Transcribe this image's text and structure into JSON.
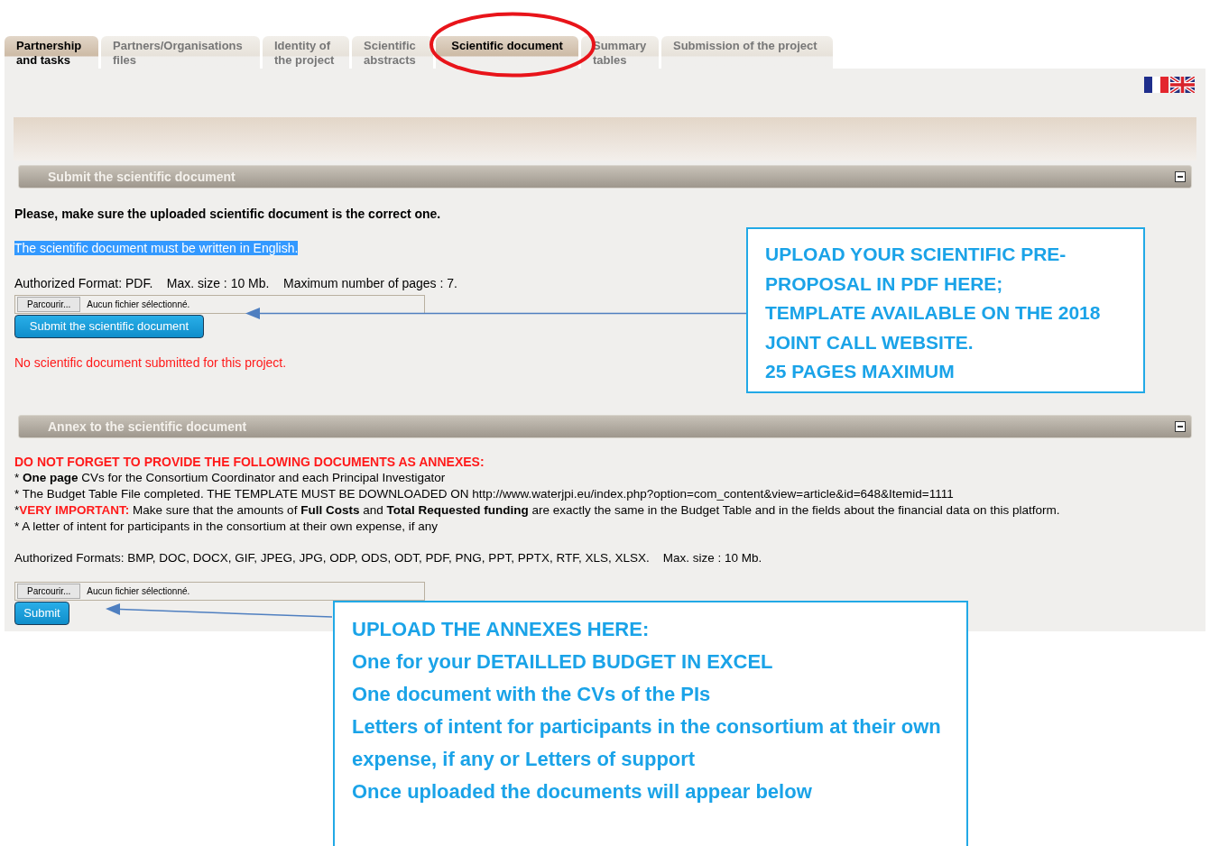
{
  "tabs": [
    {
      "label": "Partnership and tasks",
      "selected": false,
      "highlighted": true
    },
    {
      "label": "Partners/Organisations files",
      "selected": false,
      "highlighted": false
    },
    {
      "label": "Identity of the project",
      "selected": false,
      "highlighted": false
    },
    {
      "label": "Scientific abstracts",
      "selected": false,
      "highlighted": false
    },
    {
      "label": "Scientific document",
      "selected": true,
      "highlighted": true
    },
    {
      "label": "Summary tables",
      "selected": false,
      "highlighted": false
    },
    {
      "label": "Submission of the project",
      "selected": false,
      "highlighted": false
    }
  ],
  "submit_section": {
    "title": "Submit the scientific document",
    "expanded": true,
    "notice": "Please, make sure the uploaded scientific document is the correct one.",
    "language_note": "The scientific document must be written in English.",
    "format_info": "Authorized Format: PDF.    Max. size : 10 Mb.    Maximum number of pages : 7.",
    "file_input": {
      "button": "Parcourir...",
      "status": "Aucun fichier sélectionné."
    },
    "submit_button": "Submit the scientific document",
    "error": "No scientific document submitted for this project."
  },
  "annex_section": {
    "title": "Annex to the scientific document",
    "expanded": true,
    "heading": "DO NOT FORGET TO PROVIDE THE FOLLOWING DOCUMENTS AS ANNEXES:",
    "items": [
      {
        "text": "* **One page** CVs for the Consortium Coordinator and each Principal Investigator"
      },
      {
        "text": "* The Budget Table File completed. THE TEMPLATE MUST BE DOWNLOADED ON http://www.waterjpi.eu/index.php?option=com_content&view=article&id=648&Itemid=1111"
      },
      {
        "marker": "*",
        "alert": "VERY IMPORTANT:",
        "text": " Make sure that the amounts of **Full Costs** and **Total Requested funding** are exactly the same in the Budget Table and in the fields about the financial data on this platform."
      },
      {
        "text": "* A letter of intent for participants in the consortium at their own expense, if any"
      }
    ],
    "format_info": "Authorized Formats: BMP, DOC, DOCX, GIF, JPEG, JPG, ODP, ODS, ODT, PDF, PNG, PPT, PPTX, RTF, XLS, XLSX.    Max. size : 10 Mb.",
    "file_input": {
      "button": "Parcourir...",
      "status": "Aucun fichier sélectionné."
    },
    "submit_button": "Submit"
  },
  "callouts": [
    {
      "paragraphs": [
        "UPLOAD YOUR SCIENTIFIC PRE-PROPOSAL IN PDF HERE; TEMPLATE AVAILABLE ON THE 2018 JOINT CALL WEBSITE.",
        "25 PAGES MAXIMUM"
      ]
    },
    {
      "paragraphs": [
        "UPLOAD THE ANNEXES HERE:",
        "One for your DETAILLED BUDGET IN EXCEL",
        "One document with the CVs of the PIs",
        "Letters of intent for participants in the consortium at their own expense, if any or Letters of support",
        "Once uploaded the documents will appear below"
      ]
    }
  ]
}
